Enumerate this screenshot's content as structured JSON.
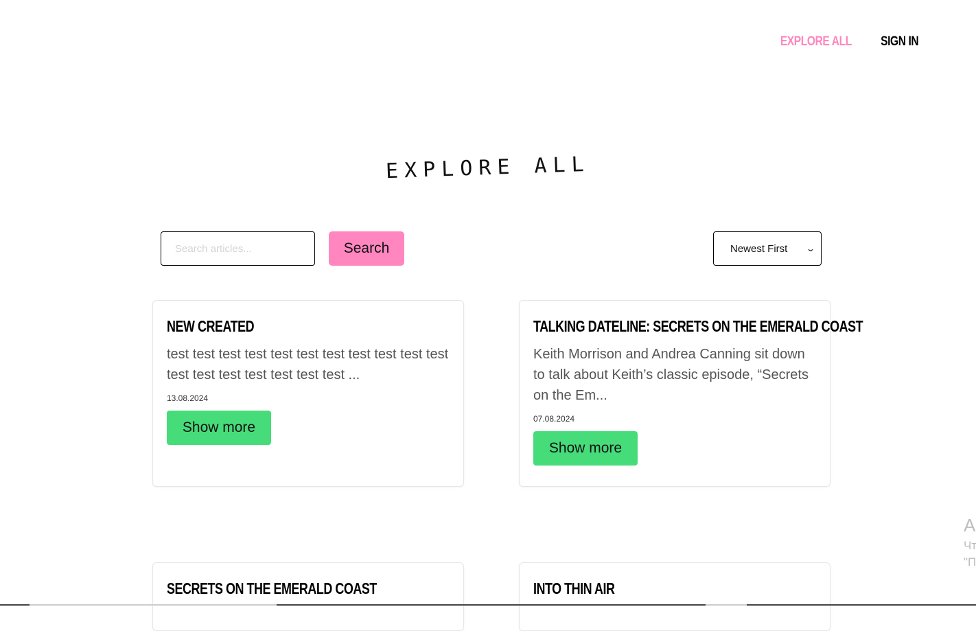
{
  "nav": {
    "explore_all": "EXPLORE ALL",
    "sign_in": "SIGN IN"
  },
  "hero": {
    "title": "EXPLORE ALL"
  },
  "search": {
    "placeholder": "Search articles...",
    "button_label": "Search"
  },
  "sort": {
    "selected": "Newest First"
  },
  "articles": [
    {
      "title": "NEW CREATED",
      "excerpt": "test test test test test test test test test test test test test test test test test test ...",
      "date": "13.08.2024",
      "button": "Show more"
    },
    {
      "title": "TALKING DATELINE: SECRETS ON THE EMERALD COAST",
      "excerpt": "Keith Morrison and Andrea Canning sit down to talk about Keith’s classic episode, “Secrets on the Em...",
      "date": "07.08.2024",
      "button": "Show more"
    },
    {
      "title": "SECRETS ON THE EMERALD COAST"
    },
    {
      "title": "INTO THIN AIR"
    }
  ],
  "overlay": {
    "line1": "Ак",
    "line2": "Чт",
    "line3": "\"П"
  },
  "colors": {
    "accent_pink": "#ff86bf",
    "accent_green": "#46dc7a",
    "text_gray": "#555555"
  }
}
